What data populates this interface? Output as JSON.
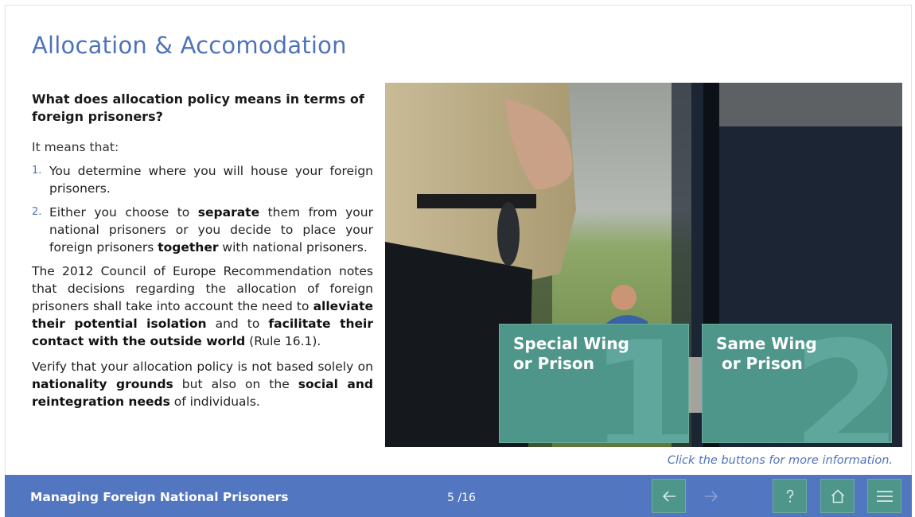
{
  "slide": {
    "title": "Allocation & Accomodation"
  },
  "content": {
    "question": "What does allocation policy means in terms of foreign prisoners?",
    "intro": "It means that:",
    "points": [
      {
        "num": "1.",
        "text": "You determine where you will house your foreign prisoners."
      },
      {
        "num": "2.",
        "pre": "Either you choose to ",
        "b1": "separate",
        "mid": " them from your national prisoners or you decide to place your foreign prisoners ",
        "b2": "together",
        "post": " with national prisoners."
      }
    ],
    "para1": {
      "pre": "The 2012 Council of Europe Recommendation notes that decisions regarding the allocation of foreign prisoners shall take into account the need to ",
      "b1": "alleviate their potential isolation",
      "mid": " and to ",
      "b2": "facilitate their contact with the outside world",
      "post": " (Rule 16.1)."
    },
    "para2": {
      "pre": "Verify that your allocation policy is not based solely on ",
      "b1": "nationality grounds",
      "mid": " but also on the ",
      "b2": "social and reintegration needs",
      "post": " of individuals."
    }
  },
  "cards": [
    {
      "label": "Special Wing\nor Prison",
      "number": "1"
    },
    {
      "label": "Same Wing\n or Prison",
      "number": "2"
    }
  ],
  "hint": "Click the buttons for more information.",
  "footer": {
    "course_title": "Managing Foreign National Prisoners",
    "page_indicator": "5 /16",
    "icons": {
      "back": "arrow-left-icon",
      "forward": "arrow-right-icon",
      "help": "question-icon",
      "home": "home-icon",
      "menu": "hamburger-menu-icon"
    }
  },
  "colors": {
    "accent_blue": "#4f73b8",
    "footer_blue": "#5276c0",
    "card_teal": "#4e958a",
    "card_number": "#5fa79c"
  }
}
